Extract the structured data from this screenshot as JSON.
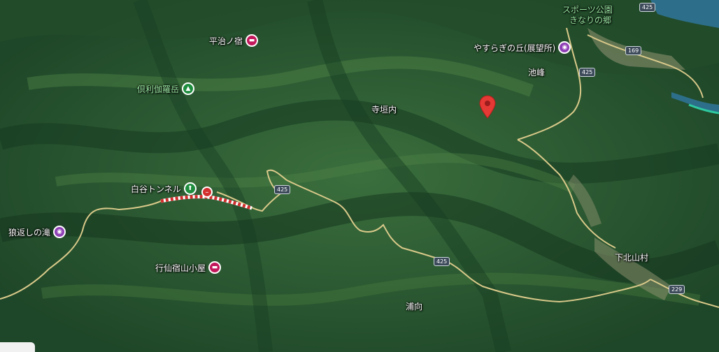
{
  "colors": {
    "forest_dark": "#1c4227",
    "forest_mid": "#2e6138",
    "forest_light": "#4a7d3f",
    "road": "#d9c98a",
    "tunnel_red": "#d32f2f",
    "marker_red": "#e53935",
    "river": "#2d6f8a"
  },
  "places": {
    "hiradi_yado": "平治ノ宿",
    "kurikara_dake": "倶利伽羅岳",
    "shiratani_tunnel": "白谷トンネル",
    "oikaeshi_falls": "狼返しの滝",
    "gyosensyuku_hut": "行仙宿山小屋",
    "terakakiuchi": "寺垣内",
    "yasuragi_hill": "やすらぎの丘(展望所)",
    "ikemine": "池峰",
    "shimokitayama": "下北山村",
    "uramukai": "浦向",
    "sports_park": "スポーツ公園",
    "kinari_no_sato": "きなりの郷"
  },
  "routes": {
    "r425_a": "425",
    "r425_b": "425",
    "r425_c": "425",
    "r425_d": "425",
    "r169": "169",
    "r229": "229"
  },
  "icons": {
    "lodging": "bed-icon",
    "mountain": "mountain-icon",
    "tunnel": "tunnel-icon",
    "attraction": "camera-icon",
    "closure": "no-entry-icon",
    "dropped_pin": "map-pin-icon"
  }
}
